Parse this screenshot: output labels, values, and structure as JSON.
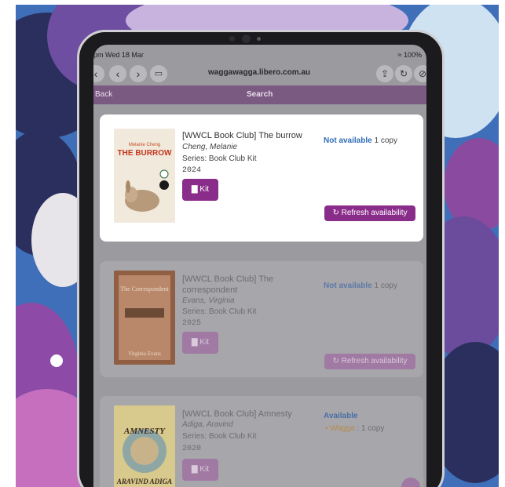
{
  "status": {
    "time": "pm  Wed 18 Mar",
    "battery": "≈ 100%"
  },
  "browser": {
    "url": "waggawagga.libero.com.au",
    "icons": [
      "chevron-left-icon",
      "chevron-right-icon",
      "tabs-icon",
      "share-icon",
      "reload-icon",
      "compass-icon"
    ]
  },
  "appbar": {
    "back_label": "Back",
    "title": "Search"
  },
  "results": [
    {
      "title": "[WWCL Book Club] The burrow",
      "author": "Cheng, Melanie",
      "series": "Series: Book Club Kit",
      "year": "2024",
      "kit_label": "Kit",
      "availability": "Not available",
      "copies": "1 copy",
      "refresh_label": "Refresh availability",
      "cover": {
        "author": "Melanie Cheng",
        "title": "THE BURROW"
      }
    },
    {
      "title": "[WWCL Book Club] The correspondent",
      "author": "Evans, Virginia",
      "series": "Series: Book Club Kit",
      "year": "2025",
      "kit_label": "Kit",
      "availability": "Not available",
      "copies": "1 copy",
      "refresh_label": "Refresh availability",
      "cover": {
        "title": "The Correspondent",
        "author": "Virginia Evans"
      }
    },
    {
      "title": "[WWCL Book Club] Amnesty",
      "author": "Adiga, Aravind",
      "series": "Series: Book Club Kit",
      "year": "2020",
      "kit_label": "Kit",
      "availability": "Available",
      "branch": "Wagga",
      "branch_copies": ": 1 copy",
      "cover": {
        "title": "AMNESTY",
        "author": "ARAVIND ADIGA"
      }
    }
  ],
  "colors": {
    "accent": "#8a2c8a",
    "not_available": "#2f6db5",
    "available": "#3c6fae",
    "branch": "#c98a2b"
  }
}
